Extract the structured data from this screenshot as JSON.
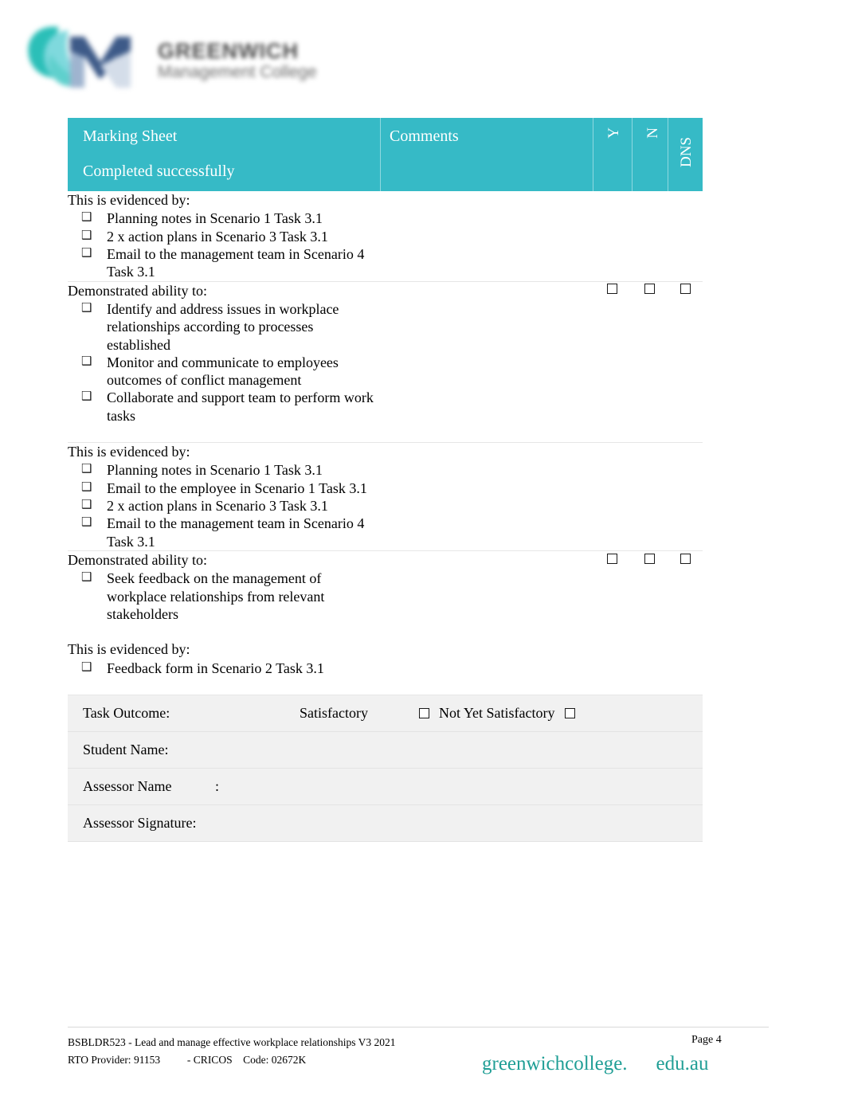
{
  "logo": {
    "monogram": "GM",
    "line1": "GREENWICH",
    "line2": "Management College"
  },
  "table": {
    "header": {
      "title": "Marking Sheet",
      "subtitle": "Completed successfully",
      "comments": "Comments",
      "col_y": "Y",
      "col_n": "N",
      "col_dns": "DNS"
    },
    "rows": [
      {
        "lead": "This is evidenced by:",
        "bullets": [
          "Planning notes in Scenario 1 Task 3.1",
          "2 x action plans in Scenario 3 Task 3.1",
          "Email to the management team in Scenario 4 Task 3.1"
        ],
        "comments": "",
        "checkboxes": false
      },
      {
        "lead": "Demonstrated ability to:",
        "bullets": [
          "Identify and address issues in workplace relationships according to processes established",
          "Monitor and communicate to employees outcomes of conflict management",
          "Collaborate and support team to perform work tasks"
        ],
        "comments": "",
        "checkboxes": true
      },
      {
        "lead": "This is evidenced by:",
        "bullets": [
          "Planning notes in Scenario 1 Task 3.1",
          "Email to the employee in Scenario 1 Task 3.1",
          "2 x action plans in Scenario 3 Task 3.1",
          "Email to the management team in Scenario 4 Task 3.1"
        ],
        "comments": "",
        "checkboxes": false
      },
      {
        "lead": "Demonstrated ability to:",
        "bullets": [
          "Seek feedback on the management of workplace relationships from relevant stakeholders"
        ],
        "lead2": "This is evidenced by:",
        "bullets2": [
          "Feedback form in Scenario 2 Task 3.1"
        ],
        "comments": "",
        "checkboxes": true
      }
    ],
    "bullet_glyph": "❑",
    "form": {
      "task_outcome_label": "Task Outcome:",
      "satisfactory_label": "Satisfactory",
      "not_yet_satisfactory_label": "Not Yet Satisfactory",
      "student_name_label": "Student Name:",
      "assessor_name_label": "Assessor Name",
      "assessor_name_colon": ":",
      "assessor_signature_label": "Assessor Signature:",
      "student_name_value": "",
      "assessor_name_value": "",
      "assessor_signature_value": ""
    }
  },
  "footer": {
    "line1": "BSBLDR523 - Lead and manage effective workplace relationships V3 2021",
    "line2": "RTO Provider: 91153          - CRICOS    Code: 02672K",
    "page": "Page 4",
    "brand_part1": "greenwichcollege.",
    "brand_part2": "edu.au"
  },
  "colors": {
    "header_teal": "#36bac6",
    "brand_teal": "#1f9e95",
    "form_row_bg": "#f1f1f1"
  }
}
